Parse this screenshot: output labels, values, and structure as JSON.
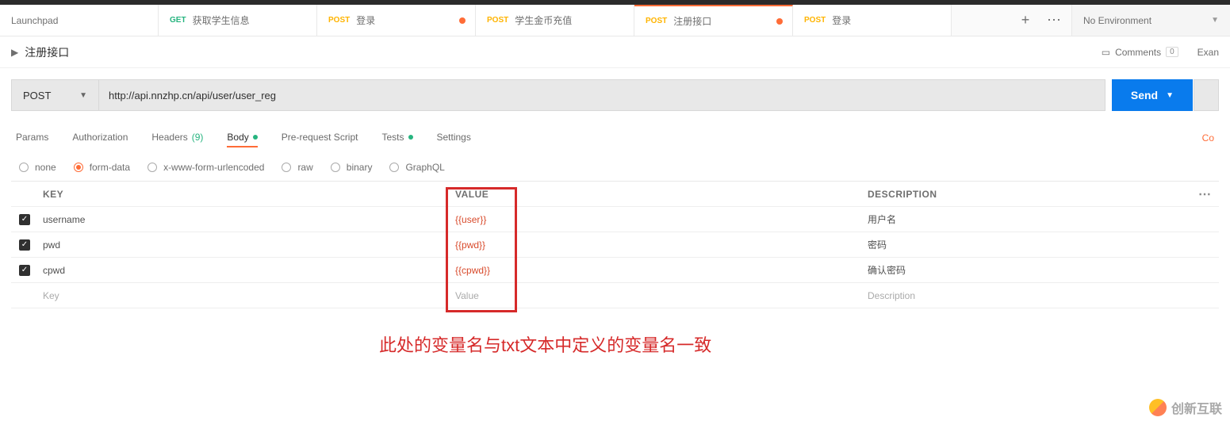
{
  "tabs": [
    {
      "method": "",
      "method_class": "",
      "name": "Launchpad",
      "has_dot": false
    },
    {
      "method": "GET",
      "method_class": "get",
      "name": "获取学生信息",
      "has_dot": false
    },
    {
      "method": "POST",
      "method_class": "post",
      "name": "登录",
      "has_dot": true
    },
    {
      "method": "POST",
      "method_class": "post",
      "name": "学生金币充值",
      "has_dot": false
    },
    {
      "method": "POST",
      "method_class": "post",
      "name": "注册接口",
      "has_dot": true,
      "active": true
    },
    {
      "method": "POST",
      "method_class": "post",
      "name": "登录",
      "has_dot": false
    }
  ],
  "env_label": "No Environment",
  "title": "注册接口",
  "comments_label": "Comments",
  "comments_count": "0",
  "exam_label": "Exan",
  "method": "POST",
  "url": "http://api.nnzhp.cn/api/user/user_reg",
  "send_label": "Send",
  "subtabs": {
    "params": "Params",
    "auth": "Authorization",
    "headers": "Headers",
    "headers_count": "(9)",
    "body": "Body",
    "prereq": "Pre-request Script",
    "tests": "Tests",
    "settings": "Settings",
    "cookies": "Co"
  },
  "body_types": [
    "none",
    "form-data",
    "x-www-form-urlencoded",
    "raw",
    "binary",
    "GraphQL"
  ],
  "body_type_selected": 1,
  "grid_headers": {
    "key": "KEY",
    "value": "VALUE",
    "desc": "DESCRIPTION"
  },
  "rows": [
    {
      "enabled": true,
      "key": "username",
      "value": "{{user}}",
      "desc": "用户名"
    },
    {
      "enabled": true,
      "key": "pwd",
      "value": "{{pwd}}",
      "desc": "密码"
    },
    {
      "enabled": true,
      "key": "cpwd",
      "value": "{{cpwd}}",
      "desc": "确认密码"
    }
  ],
  "placeholders": {
    "key": "Key",
    "value": "Value",
    "desc": "Description"
  },
  "annotation": "此处的变量名与txt文本中定义的变量名一致",
  "watermark": "创新互联"
}
